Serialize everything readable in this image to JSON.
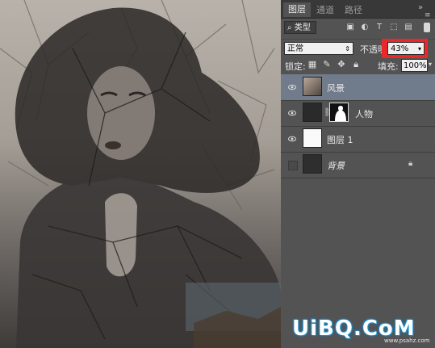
{
  "panel": {
    "tabs": [
      {
        "label": "图层",
        "active": true
      },
      {
        "label": "通道",
        "active": false
      },
      {
        "label": "路径",
        "active": false
      }
    ],
    "filter": {
      "label": "类型"
    },
    "blend_mode": "正常",
    "opacity_label": "不透明度:",
    "opacity_value": "43%",
    "lock_label": "锁定:",
    "fill_label": "填充:",
    "fill_value": "100%",
    "layers": [
      {
        "name": "风景",
        "visible": true,
        "selected": true,
        "thumb": "scenery"
      },
      {
        "name": "人物",
        "visible": true,
        "selected": false,
        "thumb": "person",
        "has_mask": true
      },
      {
        "name": "图层 1",
        "visible": true,
        "selected": false,
        "thumb": "white"
      },
      {
        "name": "背景",
        "visible": false,
        "selected": false,
        "thumb": "bg",
        "locked": true
      }
    ],
    "highlight_color": "#e8282a",
    "selected_layer_color": "#707b8c"
  },
  "watermark": {
    "main": "UiBQ.CoM",
    "sub": "www.psahz.com"
  }
}
